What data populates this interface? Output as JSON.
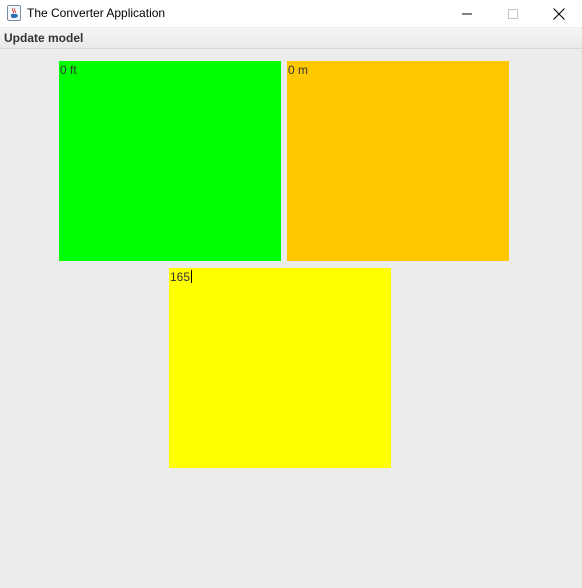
{
  "window": {
    "title": "The Converter Application",
    "icon": "java-cup-icon",
    "controls": [
      "minimize-icon",
      "maximize-icon",
      "close-icon"
    ]
  },
  "menubar": {
    "items": [
      {
        "label": "Update model"
      }
    ]
  },
  "panels": {
    "feet": {
      "label": "0 ft",
      "color": "#00ff00"
    },
    "meters": {
      "label": "0 m",
      "color": "#ffc800"
    },
    "input": {
      "value": "165",
      "color": "#ffff00"
    }
  }
}
